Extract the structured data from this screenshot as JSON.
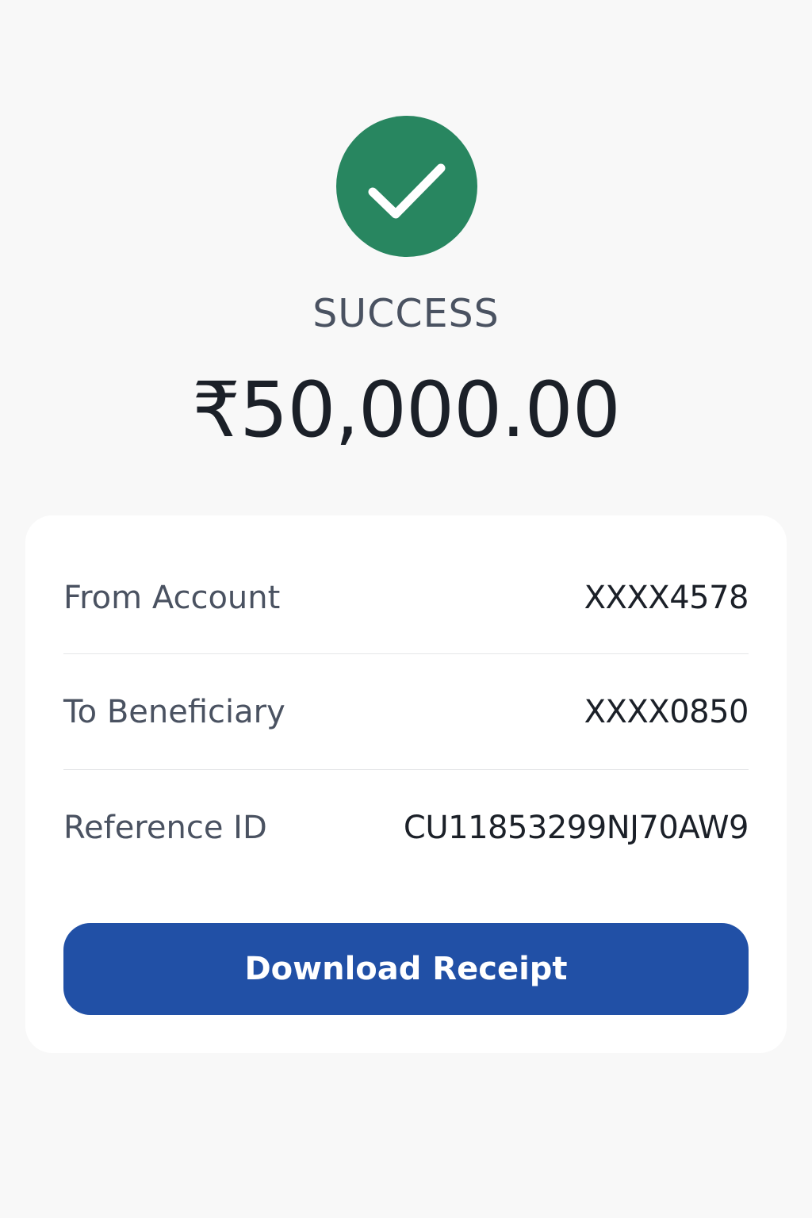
{
  "status": {
    "icon": "checkmark-icon",
    "icon_color": "#288660",
    "text": "SUCCESS"
  },
  "amount": "₹50,000.00",
  "details": [
    {
      "label": "From Account",
      "value": "XXXX4578"
    },
    {
      "label": "To Beneficiary",
      "value": "XXXX0850"
    },
    {
      "label": "Reference ID",
      "value": "CU11853299NJ70AW9"
    }
  ],
  "actions": {
    "download_label": "Download Receipt",
    "download_color": "#2150a6"
  }
}
